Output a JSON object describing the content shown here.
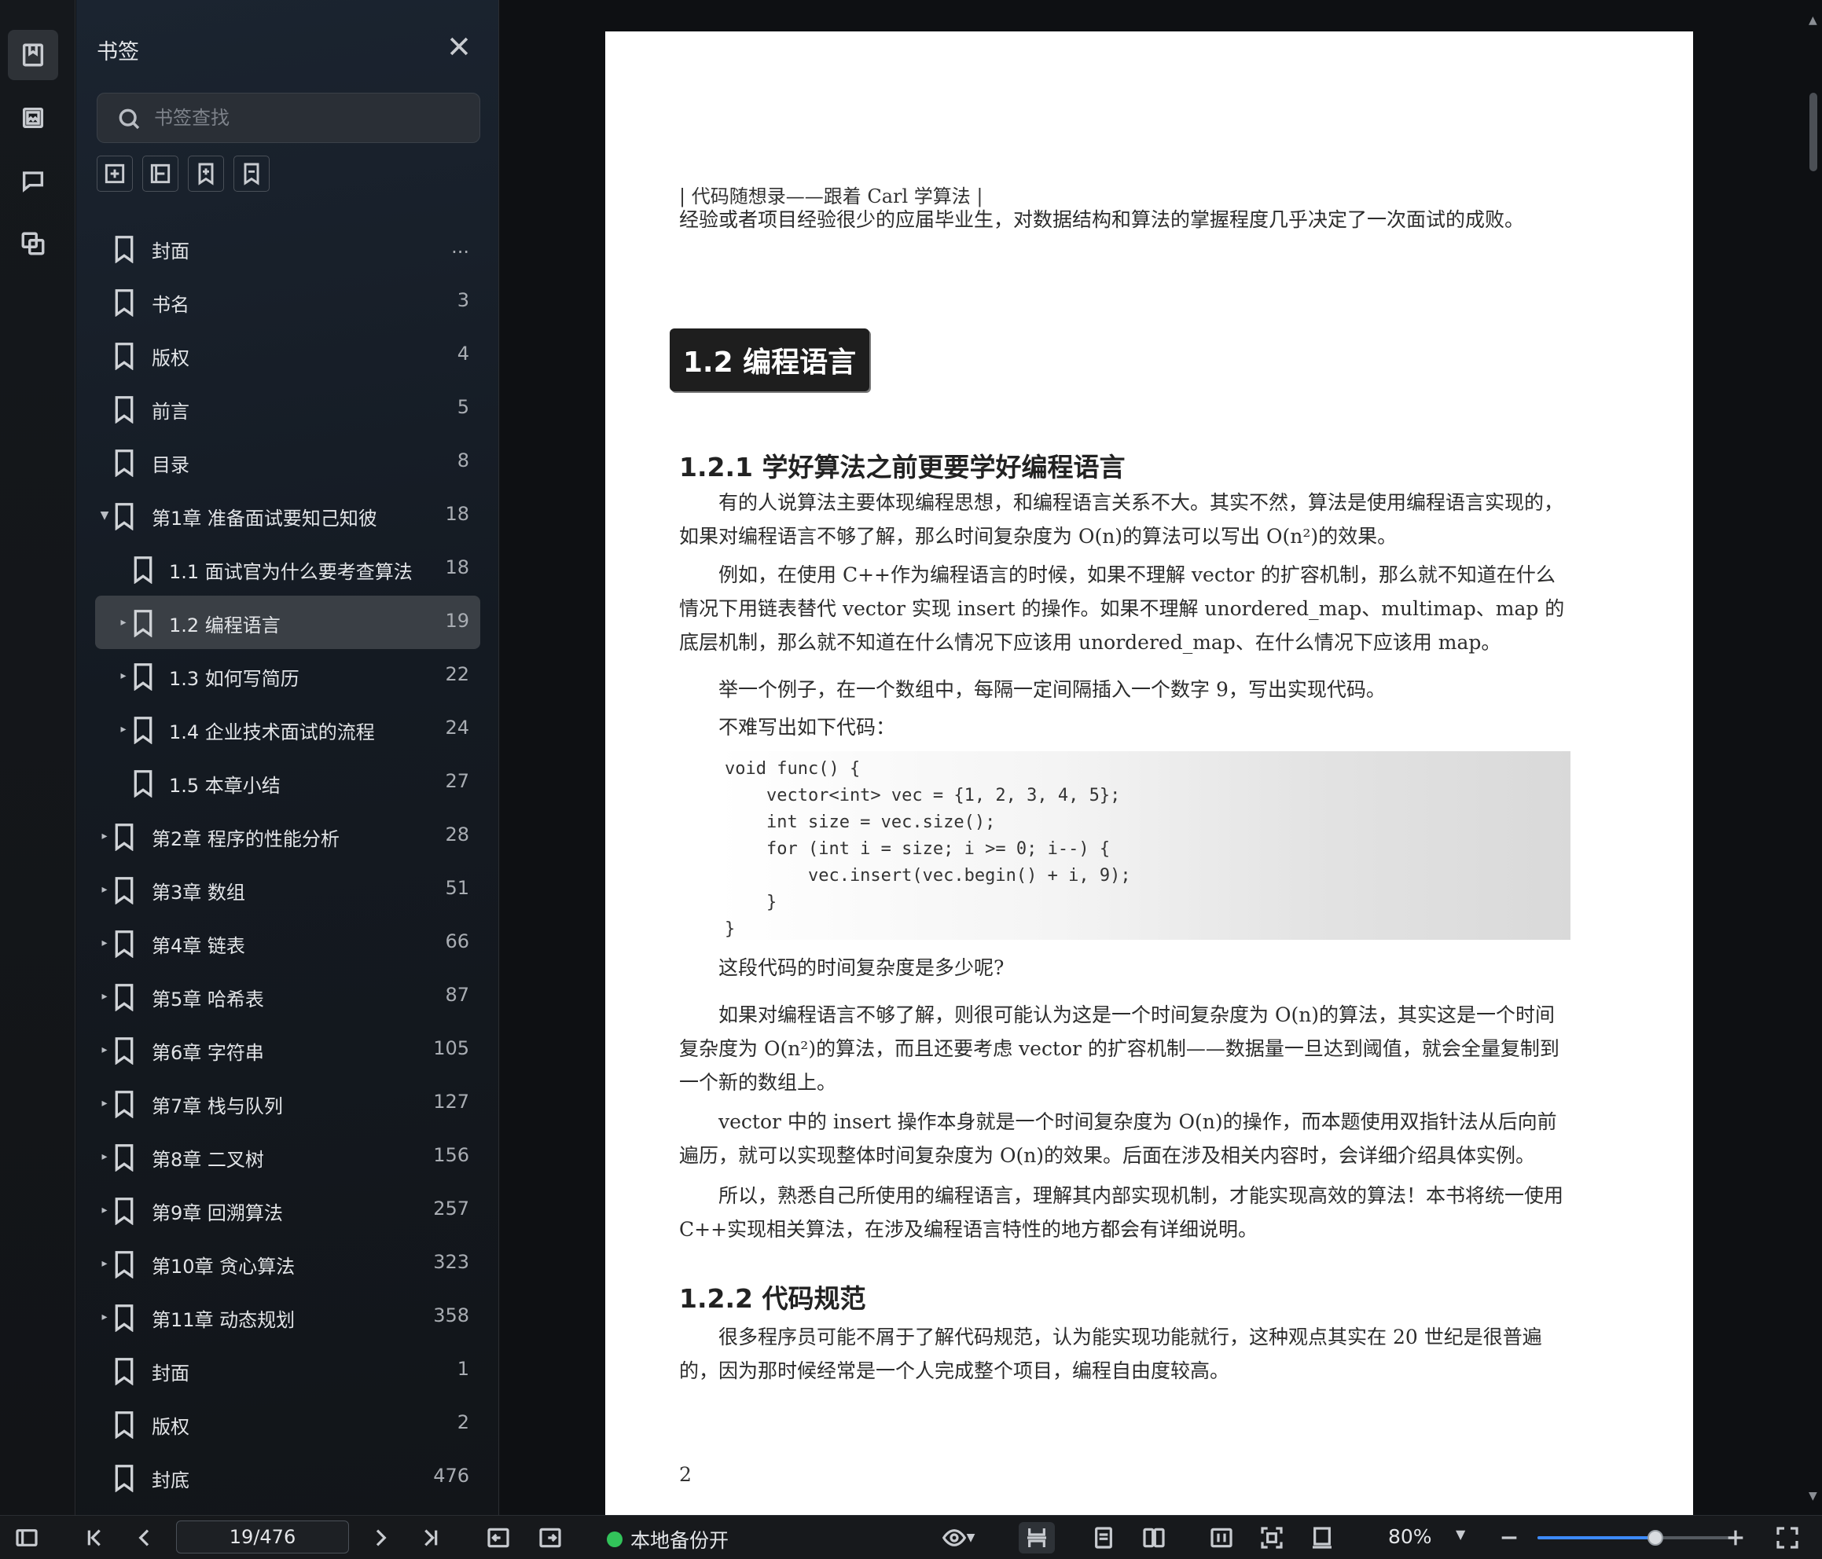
{
  "sidebar": {
    "title": "书签",
    "search": {
      "placeholder": "书签查找",
      "value": ""
    },
    "bookmarks": [
      {
        "label": "封面",
        "page": "...",
        "level": 0,
        "arrow": ""
      },
      {
        "label": "书名",
        "page": "3",
        "level": 0,
        "arrow": ""
      },
      {
        "label": "版权",
        "page": "4",
        "level": 0,
        "arrow": ""
      },
      {
        "label": "前言",
        "page": "5",
        "level": 0,
        "arrow": ""
      },
      {
        "label": "目录",
        "page": "8",
        "level": 0,
        "arrow": ""
      },
      {
        "label": "第1章 准备面试要知己知彼",
        "page": "18",
        "level": 0,
        "arrow": "▼"
      },
      {
        "label": "1.1 面试官为什么要考查算法",
        "page": "18",
        "level": 1,
        "arrow": ""
      },
      {
        "label": "1.2 编程语言",
        "page": "19",
        "level": 1,
        "arrow": "▸",
        "selected": true
      },
      {
        "label": "1.3 如何写简历",
        "page": "22",
        "level": 1,
        "arrow": "▸"
      },
      {
        "label": "1.4 企业技术面试的流程",
        "page": "24",
        "level": 1,
        "arrow": "▸"
      },
      {
        "label": "1.5 本章小结",
        "page": "27",
        "level": 1,
        "arrow": ""
      },
      {
        "label": "第2章 程序的性能分析",
        "page": "28",
        "level": 0,
        "arrow": "▸"
      },
      {
        "label": "第3章 数组",
        "page": "51",
        "level": 0,
        "arrow": "▸"
      },
      {
        "label": "第4章 链表",
        "page": "66",
        "level": 0,
        "arrow": "▸"
      },
      {
        "label": "第5章 哈希表",
        "page": "87",
        "level": 0,
        "arrow": "▸"
      },
      {
        "label": "第6章 字符串",
        "page": "105",
        "level": 0,
        "arrow": "▸"
      },
      {
        "label": "第7章 栈与队列",
        "page": "127",
        "level": 0,
        "arrow": "▸"
      },
      {
        "label": "第8章 二叉树",
        "page": "156",
        "level": 0,
        "arrow": "▸"
      },
      {
        "label": "第9章 回溯算法",
        "page": "257",
        "level": 0,
        "arrow": "▸"
      },
      {
        "label": "第10章 贪心算法",
        "page": "323",
        "level": 0,
        "arrow": "▸"
      },
      {
        "label": "第11章 动态规划",
        "page": "358",
        "level": 0,
        "arrow": "▸"
      },
      {
        "label": "封面",
        "page": "1",
        "level": 0,
        "arrow": ""
      },
      {
        "label": "版权",
        "page": "2",
        "level": 0,
        "arrow": ""
      },
      {
        "label": "封底",
        "page": "476",
        "level": 0,
        "arrow": ""
      }
    ]
  },
  "document": {
    "running_head": "| 代码随想录——跟着 Carl 学算法 |",
    "intro": "经验或者项目经验很少的应届毕业生，对数据结构和算法的掌握程度几乎决定了一次面试的成败。",
    "section_title": "1.2 编程语言",
    "sub1_title": "1.2.1 学好算法之前更要学好编程语言",
    "p1": "有的人说算法主要体现编程思想，和编程语言关系不大。其实不然，算法是使用编程语言实现的，如果对编程语言不够了解，那么时间复杂度为 O(n)的算法可以写出 O(n²)的效果。",
    "p2": "例如，在使用 C++作为编程语言的时候，如果不理解 vector 的扩容机制，那么就不知道在什么情况下用链表替代 vector 实现 insert 的操作。如果不理解 unordered_map、multimap、map 的底层机制，那么就不知道在什么情况下应该用 unordered_map、在什么情况下应该用 map。",
    "p3": "举一个例子，在一个数组中，每隔一定间隔插入一个数字 9，写出实现代码。",
    "p4": "不难写出如下代码：",
    "code": "void func() {\n    vector<int> vec = {1, 2, 3, 4, 5};\n    int size = vec.size();\n    for (int i = size; i >= 0; i--) {\n        vec.insert(vec.begin() + i, 9);\n    }\n}",
    "p5": "这段代码的时间复杂度是多少呢?",
    "p6": "如果对编程语言不够了解，则很可能认为这是一个时间复杂度为 O(n)的算法，其实这是一个时间复杂度为 O(n²)的算法，而且还要考虑 vector 的扩容机制——数据量一旦达到阈值，就会全量复制到一个新的数组上。",
    "p7": "vector 中的 insert 操作本身就是一个时间复杂度为 O(n)的操作，而本题使用双指针法从后向前遍历，就可以实现整体时间复杂度为 O(n)的效果。后面在涉及相关内容时，会详细介绍具体实例。",
    "p8": "所以，熟悉自己所使用的编程语言，理解其内部实现机制，才能实现高效的算法！本书将统一使用 C++实现相关算法，在涉及编程语言特性的地方都会有详细说明。",
    "sub2_title": "1.2.2 代码规范",
    "p9": "很多程序员可能不屑于了解代码规范，认为能实现功能就行，这种观点其实在 20 世纪是很普遍的，因为那时候经常是一个人完成整个项目，编程自由度较高。",
    "page_number": "2"
  },
  "toolbar": {
    "page_indicator": "19/476",
    "backup_label": "本地备份开",
    "zoom": "80%",
    "zoom_level": 0.8,
    "accent": "#3d8bff",
    "status_color": "#32c35a"
  }
}
